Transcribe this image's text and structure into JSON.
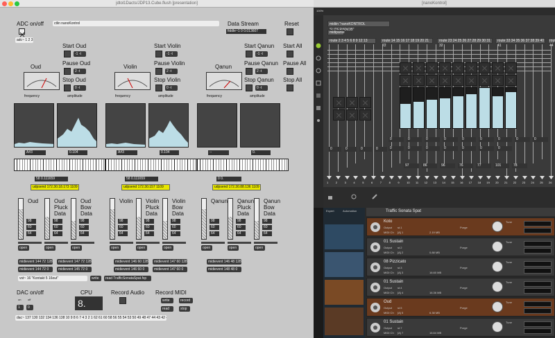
{
  "left_window": {
    "title": "jdtol1Dacts/JDP13.Cube.flush [presentation]",
    "adc": {
      "label": "ADC on/off",
      "source": "adc~ 1 2 3",
      "device": "ctlin nanoKontrol"
    },
    "data_stream": {
      "label": "Data Stream",
      "value": "fiddle~1 0 0.013607"
    },
    "reset": "Reset",
    "start_all": "Start All",
    "pause_all": "Pause All",
    "stop_all": "Stop All",
    "instruments": [
      {
        "name": "Oud",
        "start": "Start Oud",
        "pause": "Pause Oud",
        "stop": "Stop Oud",
        "freq_label": "frequency",
        "amp_label": "amplitude",
        "note": "A#3",
        "amp": "0.104",
        "num": "58 0.111659",
        "udp": "udpsend 172.30.18.173 1109"
      },
      {
        "name": "Violin",
        "start": "Start Violin",
        "pause": "Pause Violin",
        "stop": "Stop Violin",
        "freq_label": "frequency",
        "amp_label": "amplitude",
        "note": "A#3",
        "amp": "0.104",
        "num": "58 0.111659",
        "udp": "udpsend 172.30.157 1109"
      },
      {
        "name": "Qanun",
        "start": "Start Qanun",
        "pause": "Pause Qanun",
        "stop": "Stop Qanun",
        "freq_label": "frequency",
        "amp_label": "amplitude",
        "note": "--",
        "amp": "0.",
        "num": "0 0.",
        "udp": "udpsend 172.30.88.136 1109"
      }
    ],
    "start_msgs": [
      "-1 -t",
      "-1 -t",
      "-1 -t"
    ],
    "pause_msgs": [
      "2 -t",
      "2 -t",
      "2 -t"
    ],
    "stop_msgs": [
      "0 -t",
      "0 -t",
      "0 -t"
    ],
    "sliders": [
      {
        "label": "Oud",
        "vals": [
          "98",
          "60",
          "64"
        ],
        "level": 0.75
      },
      {
        "label": "Oud Pluck Data",
        "vals": [
          "98",
          "60",
          "64"
        ],
        "level": 0.55
      },
      {
        "label": "Oud Bow Data",
        "vals": [
          "98",
          "60",
          "64"
        ],
        "level": 0.45
      },
      {
        "label": "Violin",
        "vals": [
          "98",
          "60",
          "64"
        ],
        "level": 0.75
      },
      {
        "label": "Violin Pluck Data",
        "vals": [
          "98",
          "60",
          "64"
        ],
        "level": 0.55
      },
      {
        "label": "Violin Bow Data",
        "vals": [
          "98",
          "60",
          "64"
        ],
        "level": 0.45
      },
      {
        "label": "Qanun",
        "vals": [
          "98",
          "60",
          "64"
        ],
        "level": 0.75
      },
      {
        "label": "Qanun Pluck Data",
        "vals": [
          "98",
          "60",
          "64"
        ],
        "level": 0.55
      },
      {
        "label": "Qanun Bow Data",
        "vals": [
          "98",
          "60",
          "64"
        ],
        "level": 0.45
      }
    ],
    "open_label": "open",
    "midievents": [
      "midievent 144 72 128",
      "midievent 147 72 128",
      "midievent 146 60 128",
      "midievent 147 60 128",
      "midievent 146 48 128",
      "midievent 144 72 0",
      "midievent 145 72 0",
      "midievent 146 60 0",
      "midievent 147 60 0",
      "midievent 148 48 0"
    ],
    "vst": "vst~ 16 \"Kontakt 5 16out\"",
    "write": "write",
    "read_file": "read TrafficSonataSpat.fxp",
    "dac": {
      "label": "DAC on/off",
      "on": "on",
      "off": "off",
      "one": "1",
      "zero": "0"
    },
    "cpu": {
      "label": "CPU",
      "value": "8."
    },
    "record_audio": "Record Audio",
    "record_midi": {
      "label": "Record MIDI",
      "write": "write",
      "record": "record",
      "read": "read",
      "stop": "stop"
    },
    "dac_outs": "dac~ 137 130 132 134 136 138 10 9 8 6 7 4 3 2 1 62 61 60 58 56 55 54 53 50 49 48 47 44 43 42 41"
  },
  "right_window": {
    "title": "[nanoKontrol]",
    "zoom": "100%",
    "midiin": "midiin \"nanoKONTROL SLIDER/KNOB\"",
    "midiparse": "midiparse",
    "routes": [
      "route 2 3 4 5 6 8 9 12 13",
      "route 14 15 16 17 18 19 20 21 22",
      "route 23 24 25 26 27 28 29 30 31 32",
      "route 33 34 35 36 37 38 39 40 41",
      "route 44"
    ],
    "nums_left": [
      "0",
      "0",
      "0",
      "0"
    ],
    "nums_mid": [
      "0",
      "0",
      "0",
      "0",
      "0",
      "0",
      "0",
      "0",
      "0",
      "0",
      "0",
      "0",
      "0",
      "0",
      "0",
      "0"
    ],
    "values": [
      "97",
      "86",
      "96",
      "76",
      "77",
      "101",
      "78"
    ],
    "bars": [
      0.1,
      0.15,
      0.2,
      0.25,
      0.3,
      0.35,
      0.5,
      0.3,
      0.4
    ],
    "outlets": [
      "1",
      "2",
      "3",
      "4",
      "5",
      "6",
      "7",
      "8",
      "9",
      "10",
      "11",
      "12",
      "13",
      "14",
      "15",
      "16",
      "17",
      "18",
      "19",
      "20",
      "21",
      "22",
      "23",
      "24",
      "25",
      "26"
    ]
  },
  "kontakt": {
    "header": "Traffic Sonata Spat",
    "left_tabs": [
      "Expert",
      "Automation"
    ],
    "slots": [
      {
        "name": "Koto",
        "out": "st.1",
        "midi": "[A] 1",
        "mem": "2.19 MB"
      },
      {
        "name": "01 Sustain",
        "out": "st.2",
        "midi": "[A] 2",
        "mem": "0.88 MB"
      },
      {
        "name": "08 Pizzicato",
        "out": "st.3",
        "midi": "[A] 3",
        "mem": "16.60 MB"
      },
      {
        "name": "01 Sustain",
        "out": "st.4",
        "midi": "[A] 4",
        "mem": "16.36 MB"
      },
      {
        "name": "Oud",
        "out": "st.5",
        "midi": "[A] 5",
        "mem": "6.38 MB"
      },
      {
        "name": "01 Sustain",
        "out": "st.7",
        "midi": "[A] 7",
        "mem": "16.64 MB"
      }
    ],
    "tune": "Tune",
    "purge": "Purge",
    "output_label": "Output",
    "midi_label": "MIDI Ch"
  },
  "colors": {
    "accent_yellow": "#e8e600",
    "mac_red": "#ff5f57",
    "mac_yellow": "#febc2e",
    "mac_green": "#28c840",
    "orange": "#e07a2e",
    "bar_fill": "#bcdde6"
  },
  "icons": [
    "power-icon",
    "record-icon",
    "gear-icon",
    "wrench-icon",
    "lock-icon",
    "knob-icon"
  ]
}
